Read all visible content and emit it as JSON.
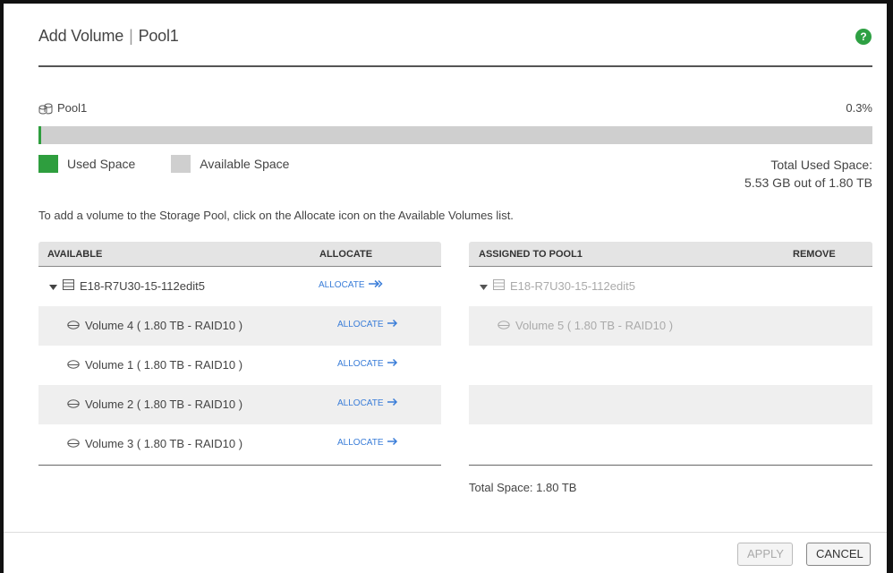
{
  "header": {
    "title": "Add Volume",
    "pool": "Pool1"
  },
  "pool": {
    "name": "Pool1",
    "percent": "0.3%",
    "used_fraction": 0.003
  },
  "legend": {
    "used": "Used Space",
    "available": "Available Space"
  },
  "total_used": {
    "label": "Total Used Space:",
    "value": "5.53 GB out of 1.80 TB"
  },
  "instruction": "To add a volume to the Storage Pool, click on the Allocate icon on the Available Volumes list.",
  "available": {
    "header_name": "AVAILABLE",
    "header_action": "ALLOCATE",
    "group": {
      "name": "E18-R7U30-15-112edit5",
      "action": "ALLOCATE"
    },
    "volumes": [
      {
        "name": "Volume 4 ( 1.80 TB - RAID10 )",
        "action": "ALLOCATE"
      },
      {
        "name": "Volume 1 ( 1.80 TB - RAID10 )",
        "action": "ALLOCATE"
      },
      {
        "name": "Volume 2 ( 1.80 TB - RAID10 )",
        "action": "ALLOCATE"
      },
      {
        "name": "Volume 3 ( 1.80 TB - RAID10 )",
        "action": "ALLOCATE"
      }
    ]
  },
  "assigned": {
    "header_name": "ASSIGNED TO POOL1",
    "header_action": "REMOVE",
    "group": {
      "name": "E18-R7U30-15-112edit5"
    },
    "volumes": [
      {
        "name": "Volume 5 ( 1.80 TB - RAID10 )"
      }
    ],
    "total_space": "Total Space: 1.80 TB"
  },
  "buttons": {
    "apply": "APPLY",
    "cancel": "CANCEL"
  },
  "colors": {
    "used": "#2e9e3e",
    "available": "#cfcfcf",
    "link": "#3a7dd8",
    "help": "#2ea043"
  },
  "icons": {
    "help": "help-icon",
    "pool": "pool-icon",
    "array": "storage-array-icon",
    "volume": "volume-icon",
    "arrow": "arrow-right-icon",
    "expand": "caret-down-icon"
  }
}
